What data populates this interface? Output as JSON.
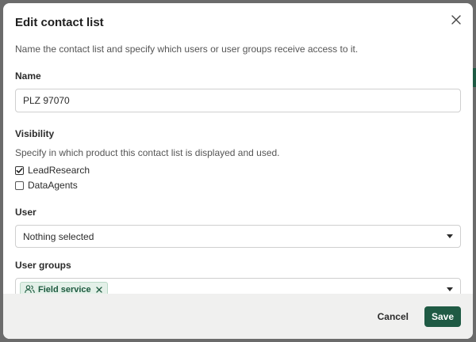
{
  "dialog": {
    "title": "Edit contact list",
    "subtitle": "Name the contact list and specify which users or user groups receive access to it."
  },
  "name_field": {
    "label": "Name",
    "value": "PLZ 97070"
  },
  "visibility": {
    "label": "Visibility",
    "helper": "Specify in which product this contact list is displayed and used.",
    "options": [
      {
        "label": "LeadResearch",
        "checked": true
      },
      {
        "label": "DataAgents",
        "checked": false
      }
    ]
  },
  "user_field": {
    "label": "User",
    "selected": "Nothing selected"
  },
  "user_groups_field": {
    "label": "User groups",
    "chips": [
      {
        "label": "Field service",
        "icon": "users-icon"
      }
    ]
  },
  "footer": {
    "cancel_label": "Cancel",
    "save_label": "Save"
  },
  "colors": {
    "accent": "#1f5a44",
    "chip_bg": "#e3f0e8",
    "footer_bg": "#f0f0ef",
    "overlay": "#6b6b6b"
  }
}
